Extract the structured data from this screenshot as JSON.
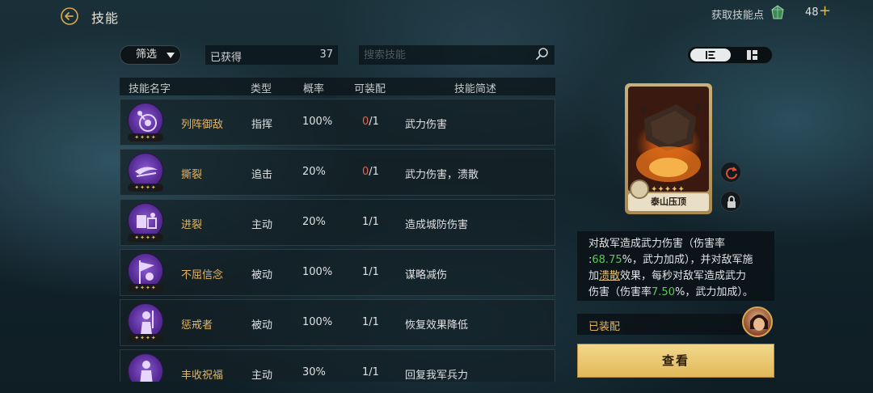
{
  "header": {
    "title": "技能",
    "points_label": "获取技能点",
    "points_value": "48",
    "points_add": "+"
  },
  "filters": {
    "filter_label": "筛选",
    "obtained_label": "已获得",
    "obtained_count": "37",
    "search_placeholder": "搜索技能"
  },
  "table": {
    "headers": [
      "技能名字",
      "类型",
      "概率",
      "可装配",
      "技能简述"
    ],
    "rows": [
      {
        "name": "列阵御敌",
        "type": "指挥",
        "rate": "100%",
        "equip_have": "0",
        "equip_total": "/1",
        "desc": "武力伤害",
        "stars": "✦✦✦✦"
      },
      {
        "name": "撕裂",
        "type": "追击",
        "rate": "20%",
        "equip_have": "0",
        "equip_total": "/1",
        "desc": "武力伤害，溃散",
        "stars": "✦✦✦✦"
      },
      {
        "name": "进裂",
        "type": "主动",
        "rate": "20%",
        "equip_have": "1",
        "equip_total": "/1",
        "desc": "造成城防伤害",
        "stars": "✦✦✦✦"
      },
      {
        "name": "不屈信念",
        "type": "被动",
        "rate": "100%",
        "equip_have": "1",
        "equip_total": "/1",
        "desc": "谋略减伤",
        "stars": "✦✦✦✦"
      },
      {
        "name": "惩戒者",
        "type": "被动",
        "rate": "100%",
        "equip_have": "1",
        "equip_total": "/1",
        "desc": "恢复效果降低",
        "stars": "✦✦✦✦"
      },
      {
        "name": "丰收祝福",
        "type": "主动",
        "rate": "30%",
        "equip_have": "1",
        "equip_total": "/1",
        "desc": "回复我军兵力",
        "stars": "✦✦✦✦"
      }
    ]
  },
  "detail": {
    "card_name": "泰山压顶",
    "card_stars": "✦✦✦✦✦",
    "desc_1": "对敌军造成武力伤害（伤害率",
    "desc_2a": ":",
    "desc_2_value": "68.75",
    "desc_2b": "%，武力加成），并对敌军施",
    "desc_3a": "加",
    "desc_3_link": "溃散",
    "desc_3b": "效果，每秒对敌军造成武力",
    "desc_4a": "伤害（伤害率",
    "desc_4_value": "7.50",
    "desc_4b": "%，武力加成）。",
    "equipped_label": "已装配",
    "view_button": "查看"
  },
  "colors": {
    "accent_gold": "#e3b665",
    "green_value": "#5cc85a",
    "red_zero": "#e2644a",
    "button_gold": "#e2b95a"
  },
  "icons": [
    "back-arrow-icon",
    "skill-point-gem-icon",
    "search-icon",
    "list-view-icon",
    "grid-view-icon",
    "reset-icon",
    "lock-icon"
  ]
}
